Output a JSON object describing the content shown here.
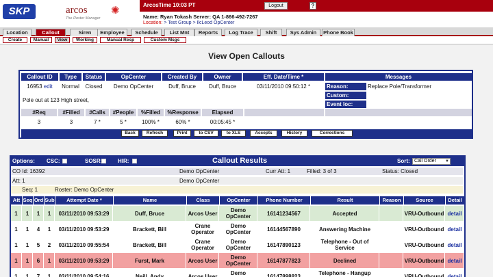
{
  "brand": {
    "logo": "SKP",
    "product": "arcos",
    "tagline": "The Roster Manager"
  },
  "topbar": {
    "time": "ArcosTime 10:03 PT",
    "logout": "Logout",
    "help": "?",
    "user_line": "Name: Ryan Tokash   Server: QA   1-866-492-7267",
    "location_label": "Location: ",
    "location_path": "> Test Group > IlcLeod OpCenter"
  },
  "tabs": [
    "Location",
    "Callout",
    "Siren",
    "Employee",
    "Schedule",
    "List Mnt",
    "Reports",
    "Log Trace",
    "Shift",
    "Sys Admin",
    "Phone Book"
  ],
  "active_tab": 1,
  "subtabs": [
    "Create",
    "Manual",
    "View",
    "Working",
    "Manual Resp",
    "Custom Msgs"
  ],
  "active_subtab": 2,
  "page_title": "View Open Callouts",
  "callout": {
    "headers": [
      "Callout ID",
      "Type",
      "Status",
      "OpCenter",
      "Created By",
      "Owner",
      "Eff. Date/Time *"
    ],
    "id": "16953",
    "edit": "edit",
    "type": "Normal",
    "status": "Closed",
    "opcenter": "Demo OpCenter",
    "created_by": "Duff, Bruce",
    "owner": "Duff, Bruce",
    "eff_datetime": "03/11/2010 09:50:12 *",
    "messages_header": "Messages",
    "reason_label": "Reason:",
    "reason_value": "Replace Pole/Transformer",
    "custom_label": "Custom:",
    "event_label": "Event loc:",
    "note": "Pole out at 123 High street,",
    "stat_headers": [
      "#Req",
      "#Filled",
      "#Calls",
      "#People",
      "%Filled",
      "%Response",
      "Elapsed"
    ],
    "stat_values": [
      "3",
      "3",
      "7 *",
      "5 *",
      "100% *",
      "60% *",
      "00:05:45 *"
    ],
    "buttons": [
      "Back",
      "Refresh",
      "Print",
      "to CSV",
      "to XLS",
      "Accepts",
      "History",
      "Corrections"
    ]
  },
  "results": {
    "options_label": "Options:",
    "csc": "CSC:",
    "sosr": "SOSR:",
    "hir": "HIR:",
    "title": "Callout Results",
    "sort_label": "Sort:",
    "sort_value": "Call Order",
    "co_id": "CO Id: 16392",
    "opcenter": "Demo OpCenter",
    "curr_att": "Curr Att: 1",
    "filled": "Filled: 3 of 3",
    "status": "Status: Closed",
    "att": "Att: 1",
    "opcenter2": "Demo OpCenter",
    "seq": "Seq: 1",
    "roster": "Roster: Demo OpCenter",
    "columns": [
      "Att",
      "Seq",
      "Ord",
      "Sub",
      "Attempt Date *",
      "Name",
      "Class",
      "OpCenter",
      "Phone Number",
      "Result",
      "Reason",
      "Source",
      "Detail"
    ],
    "rows": [
      {
        "att": "1",
        "seq": "1",
        "ord": "1",
        "sub": "1",
        "date": "03/11/2010 09:53:29",
        "name": "Duff, Bruce",
        "class": "Arcos User",
        "opcenter": "Demo OpCenter",
        "phone": "16141234567",
        "result": "Accepted",
        "reason": "",
        "source": "VRU-Outbound",
        "detail": "detail",
        "color": "#d9ead3"
      },
      {
        "att": "1",
        "seq": "1",
        "ord": "4",
        "sub": "1",
        "date": "03/11/2010 09:53:29",
        "name": "Brackett, Bill",
        "class": "Crane Operator",
        "opcenter": "Demo OpCenter",
        "phone": "16144567890",
        "result": "Answering Machine",
        "reason": "",
        "source": "VRU-Outbound",
        "detail": "detail",
        "color": "#ffffff"
      },
      {
        "att": "1",
        "seq": "1",
        "ord": "5",
        "sub": "2",
        "date": "03/11/2010 09:55:54",
        "name": "Brackett, Bill",
        "class": "Crane Operator",
        "opcenter": "Demo OpCenter",
        "phone": "16147890123",
        "result": "Telephone - Out of Service",
        "reason": "",
        "source": "VRU-Outbound",
        "detail": "detail",
        "color": "#ffffff"
      },
      {
        "att": "1",
        "seq": "1",
        "ord": "6",
        "sub": "1",
        "date": "03/11/2010 09:53:29",
        "name": "Furst, Mark",
        "class": "Arcos User",
        "opcenter": "Demo OpCenter",
        "phone": "16147877823",
        "result": "Declined",
        "reason": "",
        "source": "VRU-Outbound",
        "detail": "detail",
        "color": "#f2a1a1"
      },
      {
        "att": "1",
        "seq": "1",
        "ord": "7",
        "sub": "1",
        "date": "03/11/2010 09:54:16",
        "name": "Neill, Andy",
        "class": "Arcos User",
        "opcenter": "Demo OpCenter",
        "phone": "16147898823",
        "result": "Telephone - Hangup w/Digits Received",
        "reason": "",
        "source": "VRU-Outbound",
        "detail": "detail",
        "color": "#ffffff"
      }
    ]
  },
  "colors": {
    "brand_red": "#a8000d",
    "navy": "#1e2f8a",
    "accepted": "#d9ead3",
    "declined": "#f2a1a1"
  }
}
